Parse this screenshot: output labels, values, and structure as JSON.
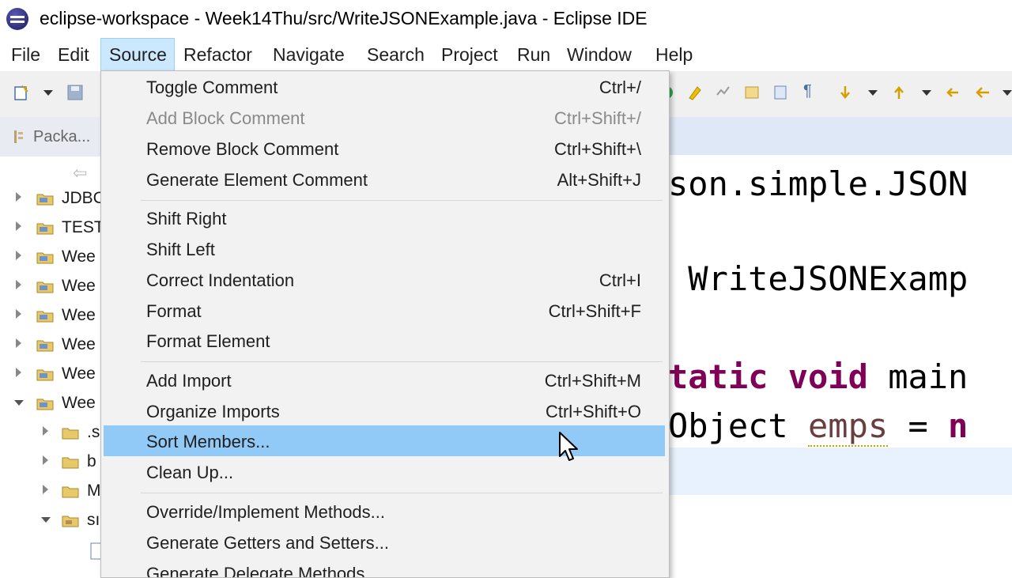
{
  "window": {
    "title": "eclipse-workspace - Week14Thu/src/WriteJSONExample.java - Eclipse IDE"
  },
  "menubar": {
    "items": [
      "File",
      "Edit",
      "Source",
      "Refactor",
      "Navigate",
      "Search",
      "Project",
      "Run",
      "Window",
      "Help"
    ],
    "active": "Source"
  },
  "explorer": {
    "tab_label": "Packa...",
    "tree": [
      {
        "label": "JDBC",
        "expanded": false
      },
      {
        "label": "TEST",
        "expanded": false
      },
      {
        "label": "Wee",
        "expanded": false
      },
      {
        "label": "Wee",
        "expanded": false
      },
      {
        "label": "Wee",
        "expanded": false
      },
      {
        "label": "Wee",
        "expanded": false
      },
      {
        "label": "Wee",
        "expanded": false
      },
      {
        "label": "Wee",
        "expanded": true
      },
      {
        "label": ".s",
        "expanded": false
      },
      {
        "label": "b",
        "expanded": false
      },
      {
        "label": "M",
        "expanded": false
      },
      {
        "label": "sı",
        "expanded": true
      }
    ]
  },
  "editor": {
    "line1": "son.simple.JSON",
    "line2": " WriteJSONExamp",
    "line3_kw1": "tatic",
    "line3_kw2": "void",
    "line3_rest": "main",
    "line4_a": "Object ",
    "line4_var": "emps",
    "line4_eq": " = ",
    "line4_kw": "n"
  },
  "source_menu": {
    "items": [
      {
        "label": "Toggle Comment",
        "shortcut": "Ctrl+/",
        "enabled": true
      },
      {
        "label": "Add Block Comment",
        "shortcut": "Ctrl+Shift+/",
        "enabled": false
      },
      {
        "label": "Remove Block Comment",
        "shortcut": "Ctrl+Shift+\\",
        "enabled": true
      },
      {
        "label": "Generate Element Comment",
        "shortcut": "Alt+Shift+J",
        "enabled": true
      },
      {
        "label": "Shift Right",
        "shortcut": "",
        "enabled": true
      },
      {
        "label": "Shift Left",
        "shortcut": "",
        "enabled": true
      },
      {
        "label": "Correct Indentation",
        "shortcut": "Ctrl+I",
        "enabled": true
      },
      {
        "label": "Format",
        "shortcut": "Ctrl+Shift+F",
        "enabled": true
      },
      {
        "label": "Format Element",
        "shortcut": "",
        "enabled": true
      },
      {
        "label": "Add Import",
        "shortcut": "Ctrl+Shift+M",
        "enabled": true
      },
      {
        "label": "Organize Imports",
        "shortcut": "Ctrl+Shift+O",
        "enabled": true
      },
      {
        "label": "Sort Members...",
        "shortcut": "",
        "enabled": true,
        "selected": true
      },
      {
        "label": "Clean Up...",
        "shortcut": "",
        "enabled": true
      },
      {
        "label": "Override/Implement Methods...",
        "shortcut": "",
        "enabled": true
      },
      {
        "label": "Generate Getters and Setters...",
        "shortcut": "",
        "enabled": true
      },
      {
        "label": "Generate Delegate Methods...",
        "shortcut": "",
        "enabled": true
      }
    ]
  },
  "colors": {
    "selection": "#91c9f7",
    "menu_active": "#cce8ff",
    "keyword": "#7f0055"
  }
}
